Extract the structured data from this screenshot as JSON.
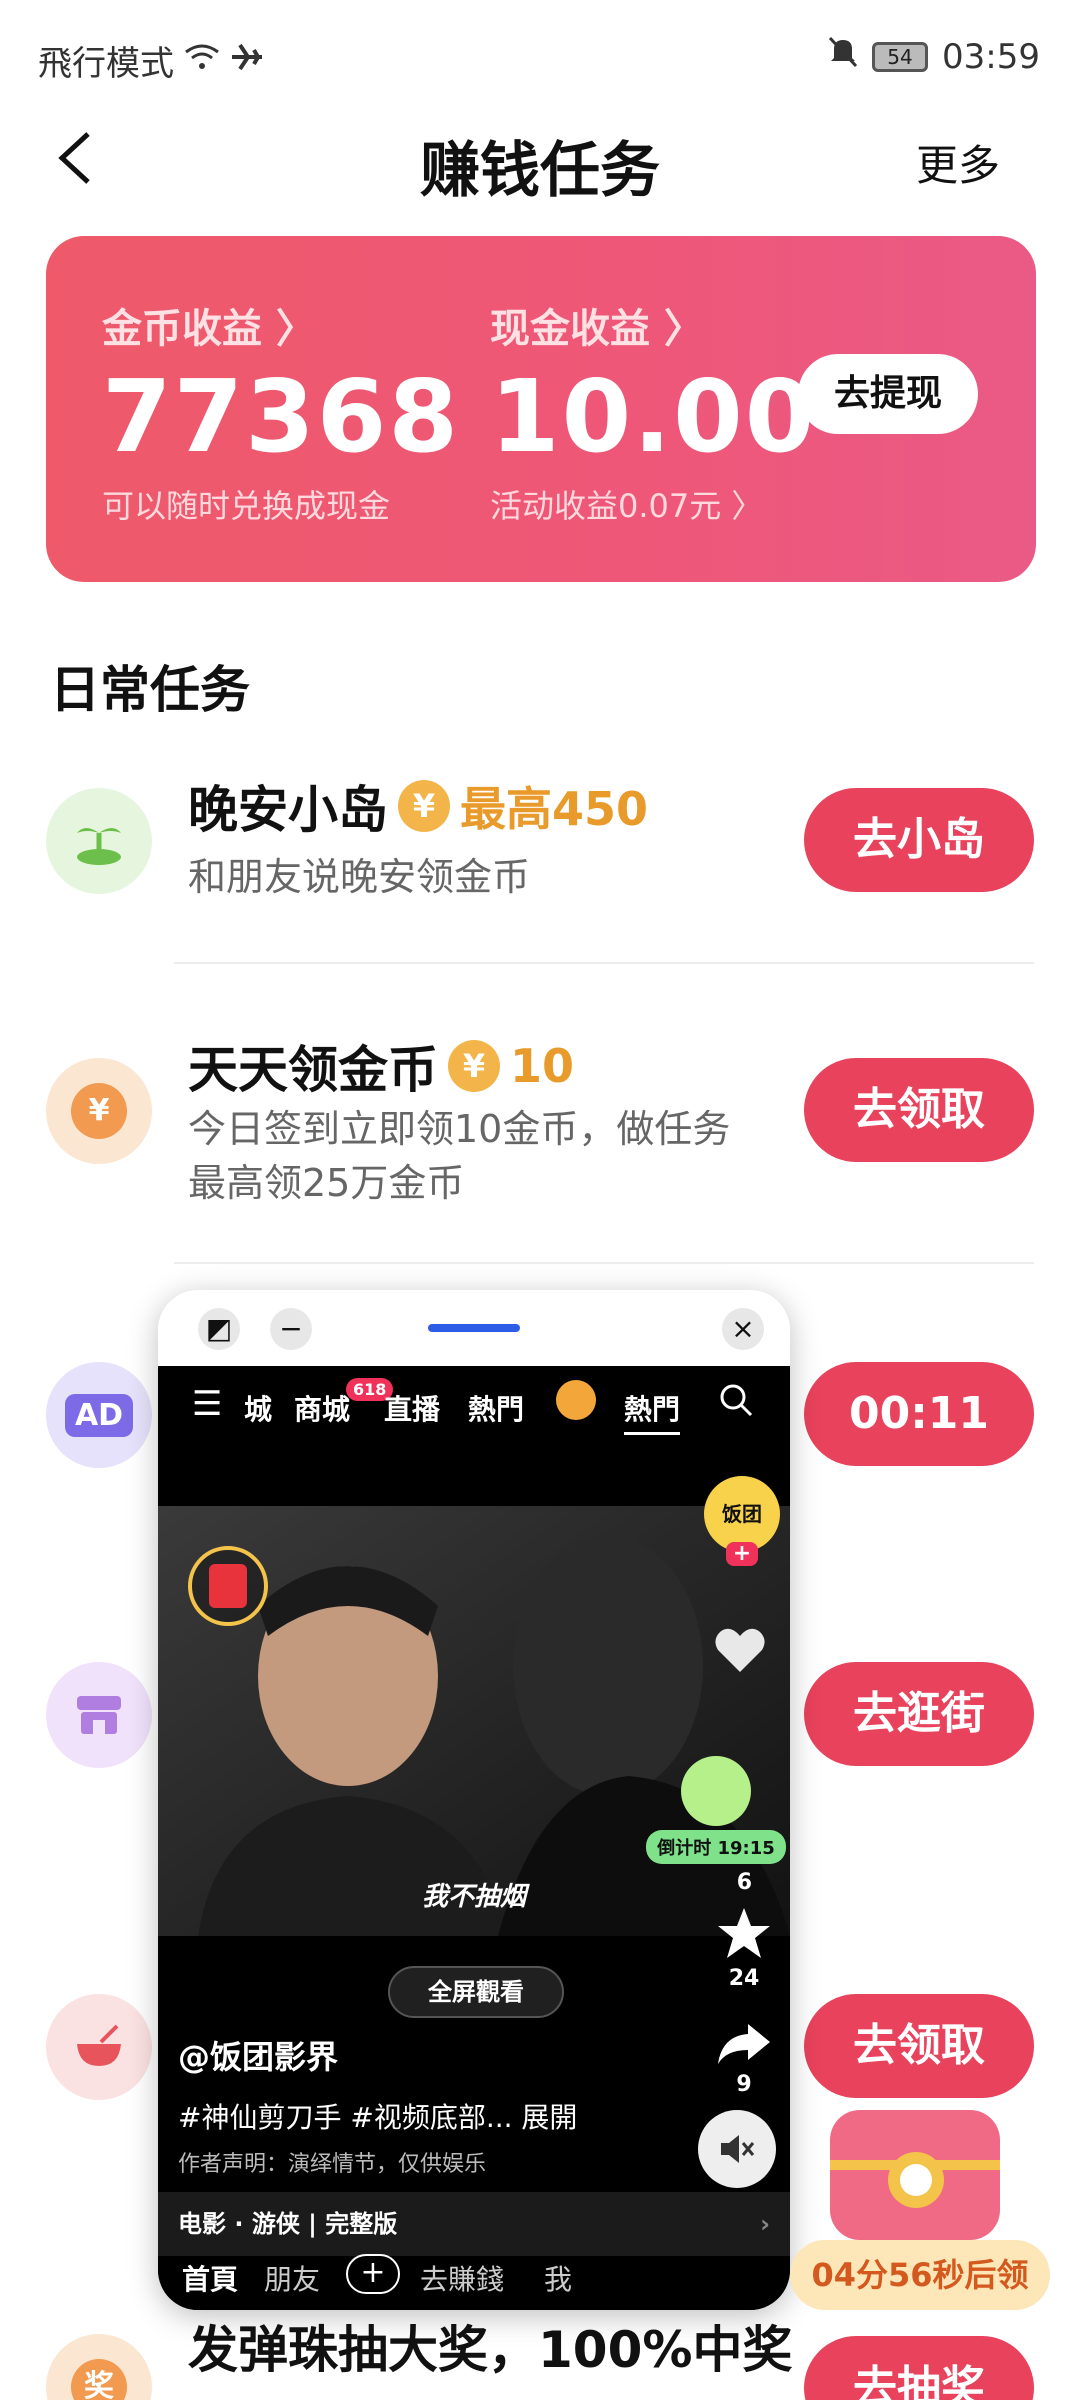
{
  "status": {
    "mode": "飛行模式",
    "battery": "54",
    "time": "03:59"
  },
  "header": {
    "title": "赚钱任务",
    "more": "更多"
  },
  "earnings": {
    "coin_label": "金币收益 〉",
    "coin_value": "77368",
    "coin_sub": "可以随时兑换成现金",
    "cash_label": "现金收益 〉",
    "cash_value": "10.00",
    "cash_sub": "活动收益0.07元 〉",
    "withdraw": "去提现"
  },
  "section_title": "日常任务",
  "tasks": [
    {
      "name": "晚安小岛",
      "reward": "最高450",
      "desc": "和朋友说晚安领金币",
      "button": "去小岛"
    },
    {
      "name": "天天领金币",
      "reward": "10",
      "desc": "今日签到立即领10金币，做任务最高领25万金币",
      "button": "去领取"
    },
    {
      "button": "00:11"
    },
    {
      "button": "去逛街"
    },
    {
      "button": "去领取"
    },
    {
      "name_partial": "发弹珠抽大奖，100%中奖",
      "button": "去抽奖"
    }
  ],
  "mini": {
    "nav": [
      "城",
      "商城",
      "直播",
      "熱門",
      "熱門"
    ],
    "nav_badge": "618",
    "caption": "我不抽烟",
    "fullscreen": "全屏觀看",
    "author": "@饭团影界",
    "tags": "#神仙剪刀手 #视频底部... 展開",
    "note": "作者声明：演绎情节，仅供娱乐",
    "movie": "电影 · 游侠 | 完整版",
    "bottom_nav": [
      "首頁",
      "朋友",
      "去賺錢",
      "我"
    ],
    "side": {
      "follow_label": "饭团",
      "countdown": "倒计时 19:15",
      "likes": "6",
      "stars": "24",
      "shares": "9"
    }
  },
  "treasure": {
    "timer": "04分56秒后领"
  },
  "colors": {
    "accent": "#e8425c",
    "coin": "#f3b54a",
    "reward": "#e89a2a"
  }
}
